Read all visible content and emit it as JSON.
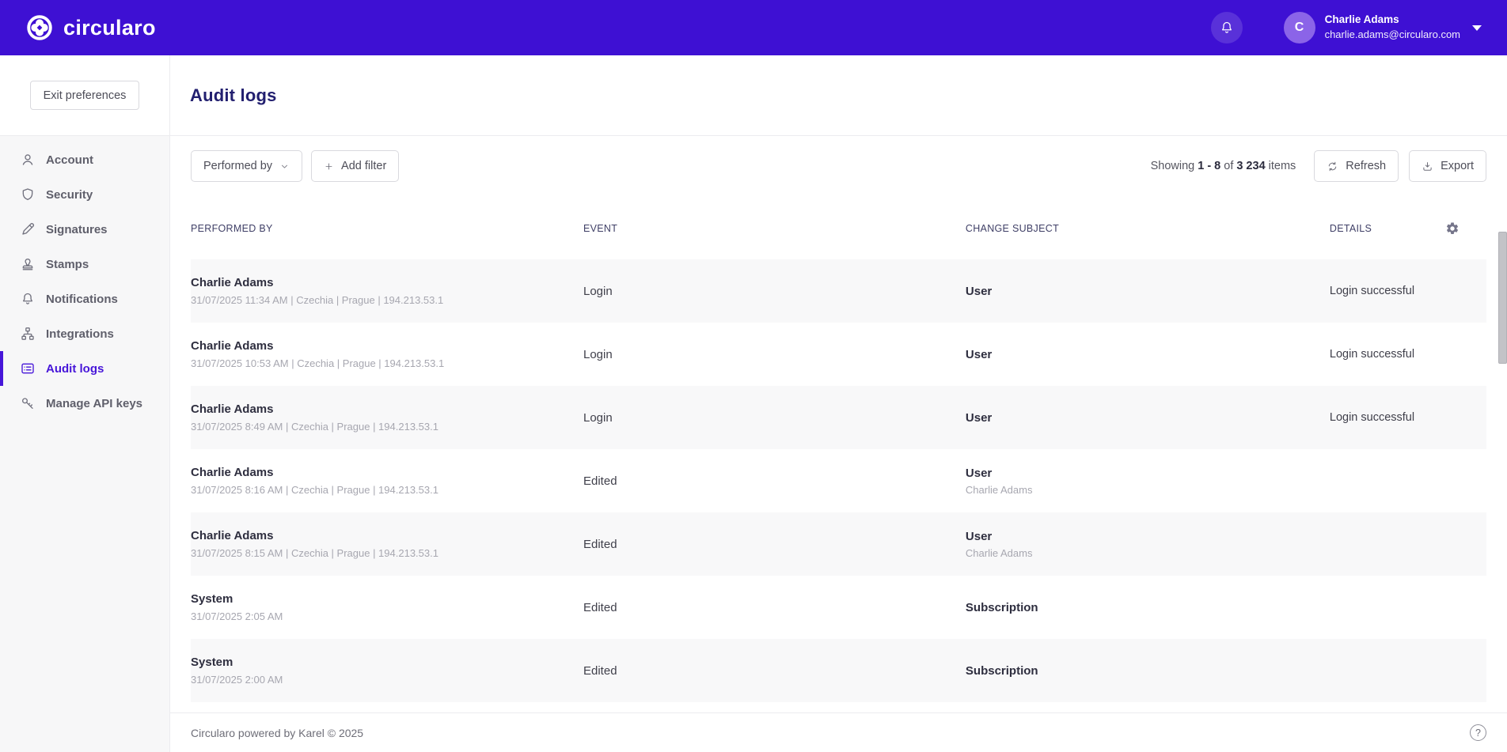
{
  "colors": {
    "brand_purple": "#3e10d3",
    "accent_purple": "#4716d9"
  },
  "navbar": {
    "brand": "circularo",
    "notification_icon": "bell-icon",
    "user": {
      "initial": "C",
      "name": "Charlie Adams",
      "email": "charlie.adams@circularo.com",
      "menu_icon": "caret-down-icon"
    }
  },
  "sidebar": {
    "exit_button": "Exit preferences",
    "items": [
      {
        "label": "Account",
        "icon": "user-icon"
      },
      {
        "label": "Security",
        "icon": "shield-icon"
      },
      {
        "label": "Signatures",
        "icon": "pen-icon"
      },
      {
        "label": "Stamps",
        "icon": "stamp-icon"
      },
      {
        "label": "Notifications",
        "icon": "bell-icon"
      },
      {
        "label": "Integrations",
        "icon": "sitemap-icon"
      },
      {
        "label": "Audit logs",
        "icon": "audit-list-icon",
        "active": true
      },
      {
        "label": "Manage API keys",
        "icon": "key-icon"
      }
    ]
  },
  "page": {
    "title": "Audit logs"
  },
  "toolbar": {
    "performed_by": {
      "label": "Performed by",
      "icon": "chevron-down-icon"
    },
    "add_filter": {
      "label": "Add filter",
      "icon": "plus-icon"
    },
    "showing": {
      "prefix": "Showing",
      "range": "1 - 8",
      "of": "of",
      "total": "3 234",
      "suffix": "items"
    },
    "refresh": {
      "label": "Refresh",
      "icon": "refresh-icon"
    },
    "export": {
      "label": "Export",
      "icon": "download-icon"
    }
  },
  "table": {
    "columns": {
      "performed_by": "PERFORMED BY",
      "event": "EVENT",
      "change_subject": "CHANGE SUBJECT",
      "details": "DETAILS"
    },
    "settings_icon": "gear-icon",
    "rows": [
      {
        "performer": "Charlie Adams",
        "meta": "31/07/2025 11:34 AM | Czechia | Prague | 194.213.53.1",
        "event": "Login",
        "subject": "User",
        "subject_sub": "",
        "details": "Login successful"
      },
      {
        "performer": "Charlie Adams",
        "meta": "31/07/2025 10:53 AM | Czechia | Prague | 194.213.53.1",
        "event": "Login",
        "subject": "User",
        "subject_sub": "",
        "details": "Login successful"
      },
      {
        "performer": "Charlie Adams",
        "meta": "31/07/2025 8:49 AM | Czechia | Prague | 194.213.53.1",
        "event": "Login",
        "subject": "User",
        "subject_sub": "",
        "details": "Login successful"
      },
      {
        "performer": "Charlie Adams",
        "meta": "31/07/2025 8:16 AM | Czechia | Prague | 194.213.53.1",
        "event": "Edited",
        "subject": "User",
        "subject_sub": "Charlie Adams",
        "details": ""
      },
      {
        "performer": "Charlie Adams",
        "meta": "31/07/2025 8:15 AM | Czechia | Prague | 194.213.53.1",
        "event": "Edited",
        "subject": "User",
        "subject_sub": "Charlie Adams",
        "details": ""
      },
      {
        "performer": "System",
        "meta": "31/07/2025 2:05 AM",
        "event": "Edited",
        "subject": "Subscription",
        "subject_sub": "",
        "details": ""
      },
      {
        "performer": "System",
        "meta": "31/07/2025 2:00 AM",
        "event": "Edited",
        "subject": "Subscription",
        "subject_sub": "",
        "details": ""
      }
    ]
  },
  "footer": {
    "text": "Circularo powered by Karel © 2025",
    "help_icon": "help-icon",
    "help_label": "?"
  }
}
